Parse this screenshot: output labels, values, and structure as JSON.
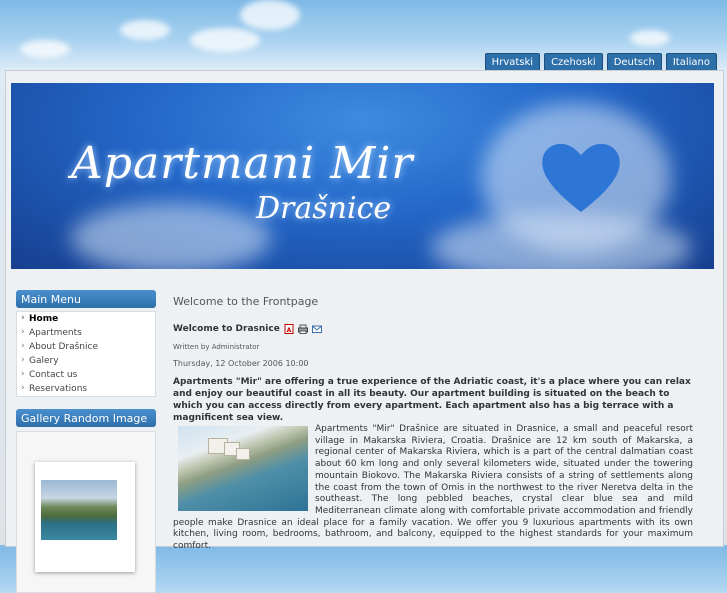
{
  "languages": [
    "Hrvatski",
    "Czehoski",
    "Deutsch",
    "Italiano"
  ],
  "banner": {
    "title": "Apartmani Mir",
    "subtitle": "Drašnice"
  },
  "main_menu": {
    "title": "Main Menu",
    "items": [
      "Home",
      "Apartments",
      "About Drašnice",
      "Galery",
      "Contact us",
      "Reservations"
    ]
  },
  "gallery": {
    "title": "Gallery Random Image"
  },
  "content": {
    "page_title": "Welcome to the Frontpage",
    "article_title": "Welcome to Drasnice",
    "author": "Written by Administrator",
    "date": "Thursday, 12 October 2006 10:00",
    "lead": "Apartments \"Mir\" are offering a true experience of the Adriatic coast, it's a place where you can relax and enjoy our beautiful coast in all its beauty. Our apartment building is situated on the beach to which you can access directly from every apartment. Each apartment also has a big terrace with a magnificent sea view.",
    "body": "Apartments \"Mir\" Drašnice are situated in Drasnice, a small and peaceful resort village in Makarska Riviera, Croatia. Drašnice are 12 km south of Makarska, a regional center of Makarska Riviera, which is a part of the central dalmatian coast about 60 km long and only several kilometers wide, situated under the towering mountain Biokovo. The Makarska Riviera consists of a string of settlements along the coast from the town of Omis in the northwest to the river Neretva delta in the southeast. The long pebbled beaches, crystal clear blue sea and mild Mediterranean climate along with comfortable private accommodation and friendly people make Drasnice an ideal place for a family vacation. We offer you 9 luxurious apartments with its own kitchen, living room, bedrooms, bathroom, and balcony, equipped to the highest standards for your maximum comfort."
  },
  "colors": {
    "tab": "#2d6fa8",
    "banner": "#2367c9"
  },
  "icons": [
    "pdf-icon",
    "print-icon",
    "email-icon"
  ]
}
